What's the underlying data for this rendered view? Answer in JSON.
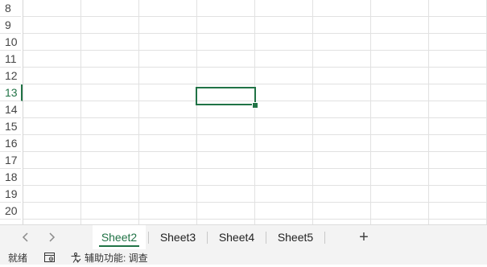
{
  "grid": {
    "row_headers": [
      "8",
      "9",
      "10",
      "11",
      "12",
      "13",
      "14",
      "15",
      "16",
      "17",
      "18",
      "19",
      "20"
    ],
    "active_row": "13"
  },
  "sheet_tabs": {
    "prev_icon": "chevron-left-icon",
    "next_icon": "chevron-right-icon",
    "tabs": [
      {
        "label": "Sheet2",
        "active": true
      },
      {
        "label": "Sheet3",
        "active": false
      },
      {
        "label": "Sheet4",
        "active": false
      },
      {
        "label": "Sheet5",
        "active": false
      }
    ],
    "add_label": "+"
  },
  "status": {
    "ready_text": "就绪",
    "accessibility_text": "辅助功能: 调查"
  },
  "colors": {
    "accent": "#217346",
    "gridline": "#e1e1e1",
    "bar_bg": "#f3f3f3"
  }
}
